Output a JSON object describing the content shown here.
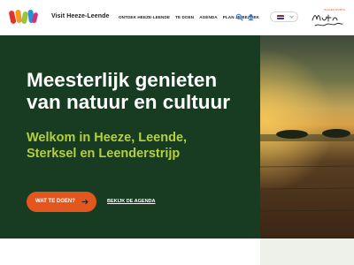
{
  "header": {
    "site_title": "Visit Heeze-Leende",
    "nav": [
      {
        "label": "ONTDEK HEEZE-LEENDE"
      },
      {
        "label": "TE DOEN"
      },
      {
        "label": "AGENDA"
      },
      {
        "label": "PLAN JE BEZOEK"
      }
    ],
    "icons": {
      "search": "search-icon",
      "user": "user-icon",
      "lang_flag": "flag-netherlands-icon",
      "chevron": "chevron-down-icon"
    },
    "brand_tag": "PLACES WORTH"
  },
  "hero": {
    "title": "Meesterlijk genieten van natuur en cultuur",
    "subtitle": "Welkom in Heeze, Leende, Sterksel en Leenderstrijp",
    "primary_cta": "WAT TE DOEN?",
    "secondary_cta": "BEKIJK DE AGENDA"
  },
  "colors": {
    "panel": "#173c21",
    "accent_green": "#b6cf3c",
    "cta_orange": "#e3571f",
    "flag": [
      "#ae1c28",
      "#ffffff",
      "#21468b"
    ]
  }
}
